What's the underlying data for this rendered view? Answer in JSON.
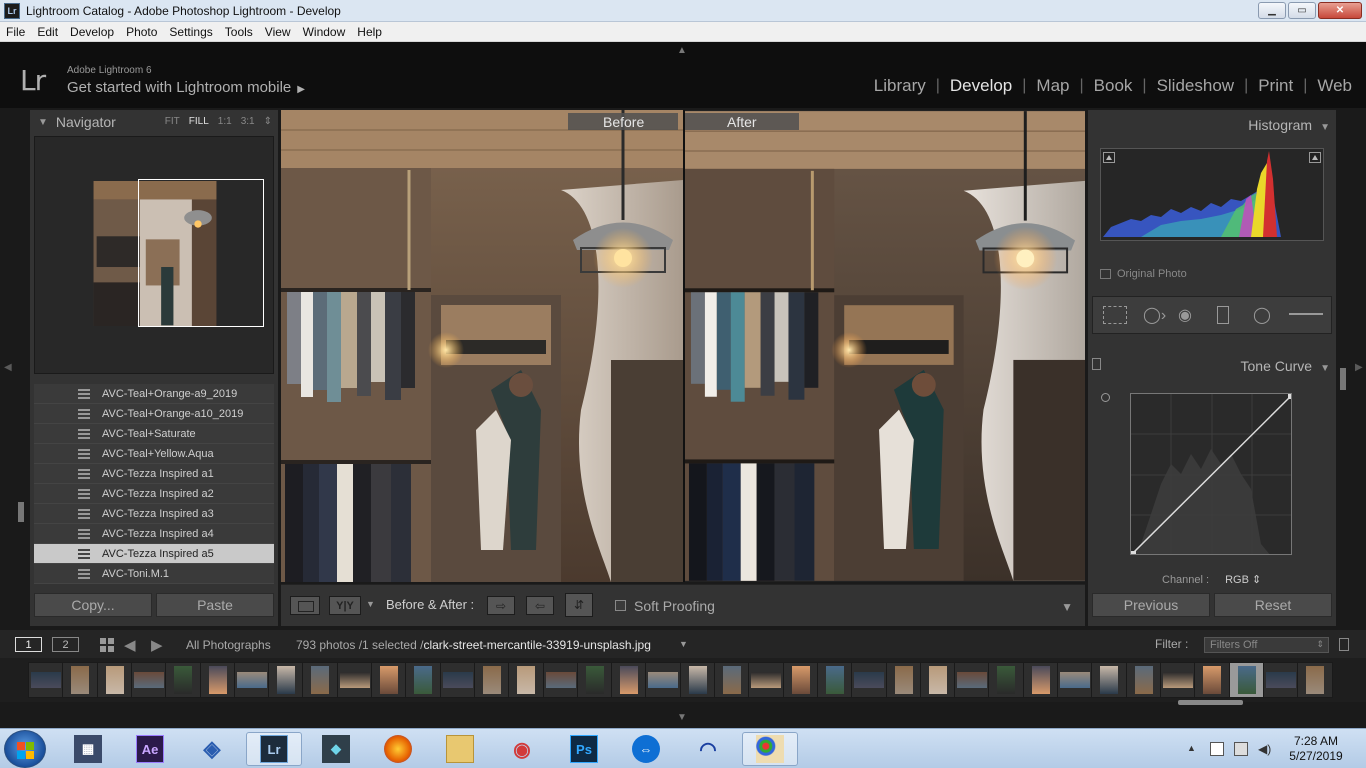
{
  "window": {
    "icon_text": "Lr",
    "title": "Lightroom Catalog - Adobe Photoshop Lightroom - Develop",
    "min": "▁",
    "max": "▭",
    "close": "✕"
  },
  "menu": [
    "File",
    "Edit",
    "Develop",
    "Photo",
    "Settings",
    "Tools",
    "View",
    "Window",
    "Help"
  ],
  "identity": {
    "logo": "Lr",
    "brand": "Adobe Lightroom 6",
    "mobile": "Get started with Lightroom mobile",
    "mobile_arrow": "▶"
  },
  "modules": [
    "Library",
    "Develop",
    "Map",
    "Book",
    "Slideshow",
    "Print",
    "Web"
  ],
  "active_module": "Develop",
  "navigator": {
    "title": "Navigator",
    "options": [
      "FIT",
      "FILL",
      "1:1",
      "3:1"
    ],
    "active_option": "FILL",
    "zoom_arrows": "⇕"
  },
  "presets": [
    "AVC-Teal+Orange-a9_2019",
    "AVC-Teal+Orange-a10_2019",
    "AVC-Teal+Saturate",
    "AVC-Teal+Yellow.Aqua",
    "AVC-Tezza Inspired a1",
    "AVC-Tezza Inspired a2",
    "AVC-Tezza Inspired a3",
    "AVC-Tezza Inspired a4",
    "AVC-Tezza Inspired a5",
    "AVC-Toni.M.1"
  ],
  "selected_preset": "AVC-Tezza Inspired a5",
  "left_buttons": {
    "copy": "Copy...",
    "paste": "Paste"
  },
  "view": {
    "before": "Before",
    "after": "After"
  },
  "toolbar": {
    "yy": "Y|Y",
    "ba_label": "Before & After :",
    "soft_proofing": "Soft Proofing",
    "copy_to_after": "⇨",
    "copy_to_before": "⇦",
    "swap": "⇵",
    "dropdown": "▼"
  },
  "histogram": {
    "title": "Histogram",
    "original_photo": "Original Photo"
  },
  "tone_curve": {
    "title": "Tone Curve",
    "channel_label": "Channel :",
    "channel_value": "RGB ⇕"
  },
  "right_buttons": {
    "previous": "Previous",
    "reset": "Reset"
  },
  "filmstrip": {
    "page1": "1",
    "page2": "2",
    "source": "All Photographs",
    "count": "793 photos /1 selected /",
    "filename": "clark-street-mercantile-33919-unsplash.jpg",
    "filter_label": "Filter :",
    "filter_value": "Filters Off",
    "thumb_count": 38,
    "selected_index": 35
  },
  "taskbar": {
    "apps": [
      "movie-maker",
      "after-effects",
      "network-app",
      "lightroom",
      "filmora",
      "firefox",
      "file-explorer",
      "camera-app",
      "photoshop",
      "teamviewer",
      "audacity",
      "paint"
    ],
    "after_effects_text": "Ae",
    "lightroom_text": "Lr",
    "photoshop_text": "Ps",
    "time": "7:28 AM",
    "date": "5/27/2019"
  },
  "colors": {
    "accent_ae": "#2b1a4a",
    "accent_lr": "#1c2c3c",
    "accent_ps": "#0e2a44"
  }
}
